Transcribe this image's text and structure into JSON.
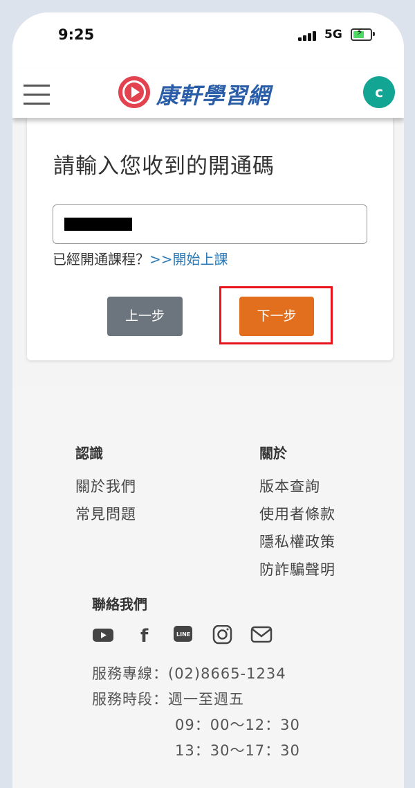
{
  "status_bar": {
    "time": "9:25",
    "network": "5G"
  },
  "header": {
    "logo_text": "康軒學習網",
    "avatar_initial": "c"
  },
  "activation": {
    "title": "請輸入您收到的開通碼",
    "input_value": "",
    "already_activated_text": "已經開通課程？",
    "start_class_link": ">>開始上課",
    "prev_button": "上一步",
    "next_button": "下一步"
  },
  "footer": {
    "col1": {
      "heading": "認識",
      "links": [
        "關於我們",
        "常見問題"
      ]
    },
    "col2": {
      "heading": "關於",
      "links": [
        "版本查詢",
        "使用者條款",
        "隱私權政策",
        "防詐騙聲明"
      ]
    },
    "contact": {
      "title": "聯絡我們",
      "social_icons": [
        "youtube-icon",
        "facebook-icon",
        "line-icon",
        "instagram-icon",
        "mail-icon"
      ],
      "hotline": "服務專線：(02)8665-1234",
      "hours_label": "服務時段：週一至週五",
      "hours_morning": "09：00～12：30",
      "hours_afternoon": "13：30～17：30"
    }
  },
  "colors": {
    "brand_blue": "#2b5ea8",
    "next_button": "#e16f1d",
    "prev_button": "#6c757d",
    "avatar": "#12a593",
    "highlight": "#e8141c"
  }
}
